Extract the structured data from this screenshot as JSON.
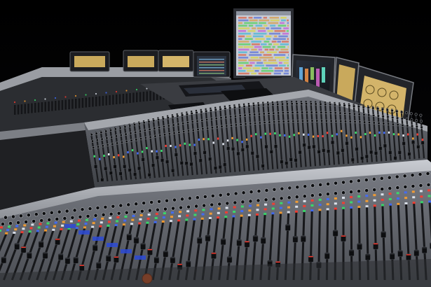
{
  "scene": {
    "subject": "large-format-mixing-console",
    "colors": {
      "background": "#030304",
      "console_body": "#5c5f66",
      "console_body_light": "#8a8d94",
      "console_panel": "#2a2c31",
      "console_panel_dark": "#17181b",
      "rail": "#b9bcc2",
      "meter_amber": "#d8b766",
      "screen_frame": "#1b1c20",
      "fader_cap": "#0d0e10",
      "led_red": "#ff3a2e",
      "led_green": "#36e36a",
      "led_blue": "#3f6bff",
      "led_orange": "#ffa12e",
      "led_white": "#e9eef8"
    }
  }
}
